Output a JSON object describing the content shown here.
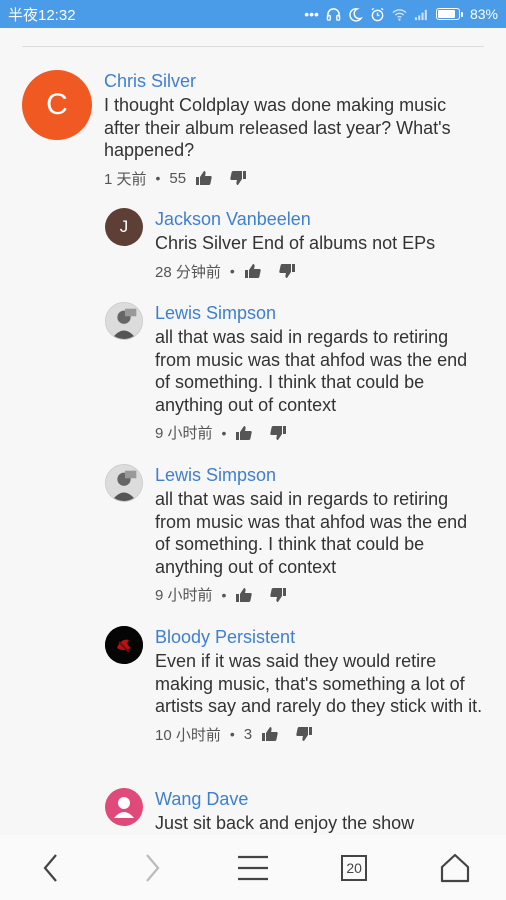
{
  "status_bar": {
    "time": "半夜12:32",
    "dots": "•••",
    "battery": "83%"
  },
  "comments": [
    {
      "author": "Chris Silver",
      "avatar_letter": "C",
      "avatar_color": "#f05a22",
      "text": "I thought Coldplay was done making music after their album released last year? What's happened?",
      "time": "1 天前",
      "likes": "55"
    },
    {
      "author": "Jackson Vanbeelen",
      "avatar_letter": "J",
      "avatar_color": "#5d3f36",
      "text": "Chris Silver End of albums not EPs",
      "time": "28 分钟前",
      "likes": ""
    },
    {
      "author": "Lewis Simpson",
      "text": "all that was said in regards to retiring from music was that ahfod was the end of something. I think that could be anything out of context",
      "time": "9 小时前",
      "likes": ""
    },
    {
      "author": "Lewis Simpson",
      "text": "all that was said in regards to retiring from music was that ahfod was the end of something. I think that could be anything out of context",
      "time": "9 小时前",
      "likes": ""
    },
    {
      "author": "Bloody Persistent",
      "text": "Even if it was said they would retire making music, that's something a lot of artists say and rarely do they stick with it.",
      "time": "10 小时前",
      "likes": "3"
    },
    {
      "author": "Wang Dave",
      "avatar_color": "#e04a7a",
      "text": "Just sit back and enjoy the show",
      "time": "",
      "likes": ""
    }
  ],
  "bottom_nav": {
    "tab_count": "20"
  }
}
